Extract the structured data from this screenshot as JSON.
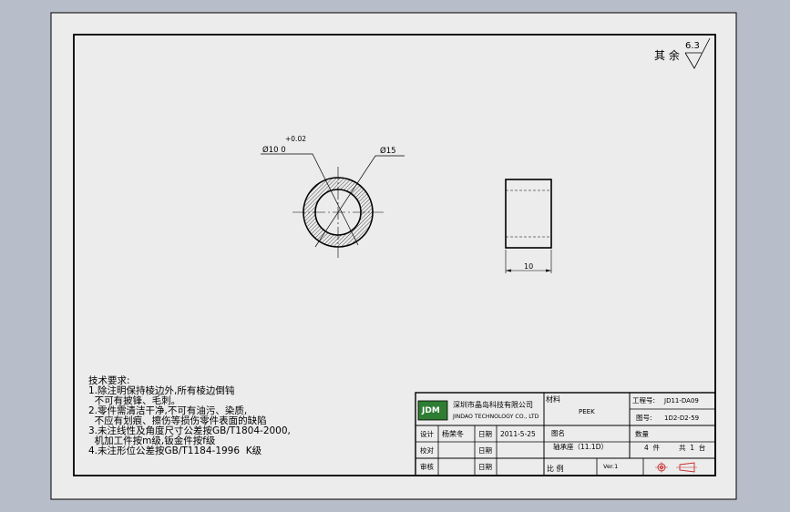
{
  "roughness": {
    "prefix": "其 余",
    "value": "6.3"
  },
  "front_view": {
    "tolerance": "+0.02",
    "inner_dia_label": "Ø10  0",
    "outer_dia_label": "Ø15"
  },
  "side_view": {
    "length_label": "10"
  },
  "notes": {
    "title": "技术要求:",
    "lines": [
      "1.除注明保持棱边外,所有棱边倒钝",
      "  不可有披锋、毛刺。",
      "2.零件需清洁干净,不可有油污、染质,",
      "  不应有划痕、擦伤等损伤零件表面的缺陷",
      "3.未注线性及角度尺寸公差按GB/T1804-2000,",
      "  机加工件按m级,钣金件按f级",
      "4.未注形位公差按GB/T1184-1996  K级"
    ]
  },
  "title_block": {
    "logo_text": "JDM",
    "company_cn": "深圳市晶岛科技有限公司",
    "company_en": "JINDAO TECHNOLOGY CO., LTD",
    "material_label": "材料",
    "material_value": "PEEK",
    "project_no_label": "工程号:",
    "project_no_value": "JD11-DA09",
    "drawing_no_label": "图号:",
    "drawing_no_value": "1D2-D2-59",
    "design_label": "设计",
    "designer": "杨荣冬",
    "date_label": "日期",
    "date_value": "2011-5-25",
    "check_label": "校对",
    "check_date_label": "日期",
    "name_label": "图名",
    "name_value": "轴承座（11.1D）",
    "qty_label": "数量",
    "qty_value": "4  件",
    "sets_value": "共  1  台",
    "approve_label": "审核",
    "approve_date_label": "日期",
    "scale_label": "比 例",
    "version_value": "Ver.1"
  }
}
